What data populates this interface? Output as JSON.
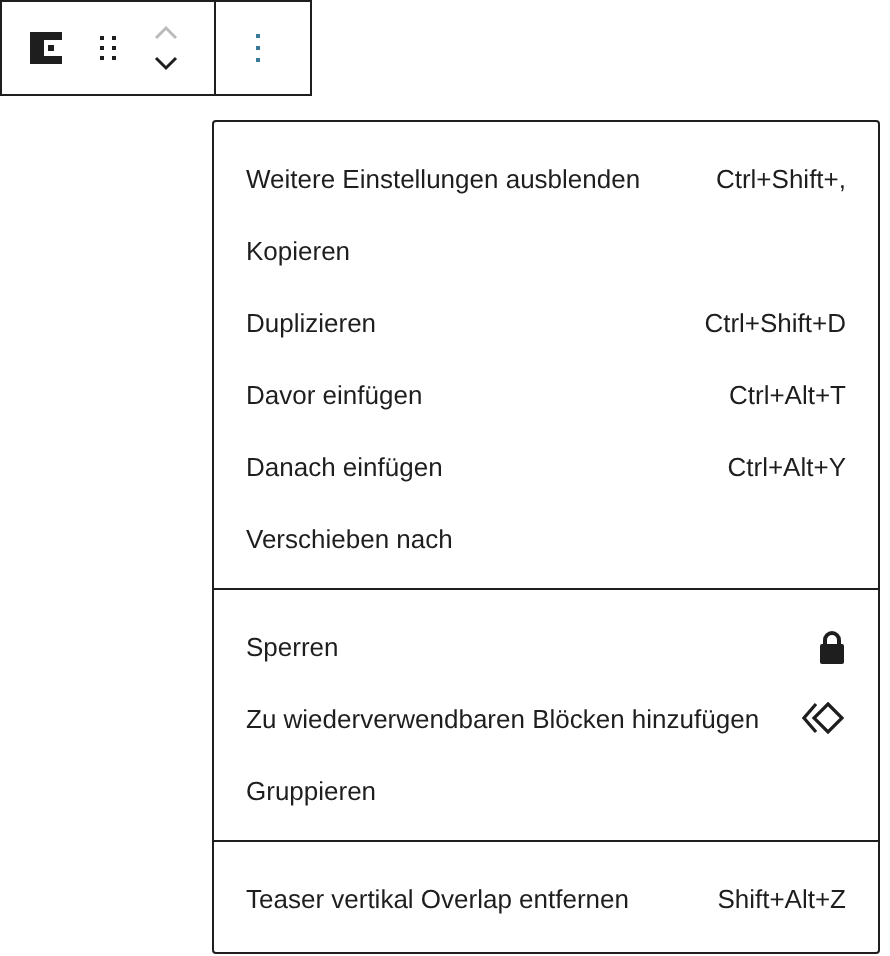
{
  "toolbar": {
    "menu_open": true
  },
  "menu_groups": [
    {
      "items": [
        {
          "kind": "shortcut",
          "label": "Weitere Einstellungen ausblenden",
          "shortcut": "Ctrl+Shift+,"
        },
        {
          "kind": "plain",
          "label": "Kopieren"
        },
        {
          "kind": "shortcut",
          "label": "Duplizieren",
          "shortcut": "Ctrl+Shift+D"
        },
        {
          "kind": "shortcut",
          "label": "Davor einfügen",
          "shortcut": "Ctrl+Alt+T"
        },
        {
          "kind": "shortcut",
          "label": "Danach einfügen",
          "shortcut": "Ctrl+Alt+Y"
        },
        {
          "kind": "plain",
          "label": "Verschieben nach"
        }
      ]
    },
    {
      "items": [
        {
          "kind": "lock",
          "label": "Sperren"
        },
        {
          "kind": "reusable",
          "label": "Zu wiederverwendbaren Blöcken hinzufügen"
        },
        {
          "kind": "plain",
          "label": "Gruppieren"
        }
      ]
    },
    {
      "items": [
        {
          "kind": "shortcut",
          "label": "Teaser vertikal Overlap entfernen",
          "shortcut": "Shift+Alt+Z"
        }
      ]
    }
  ]
}
